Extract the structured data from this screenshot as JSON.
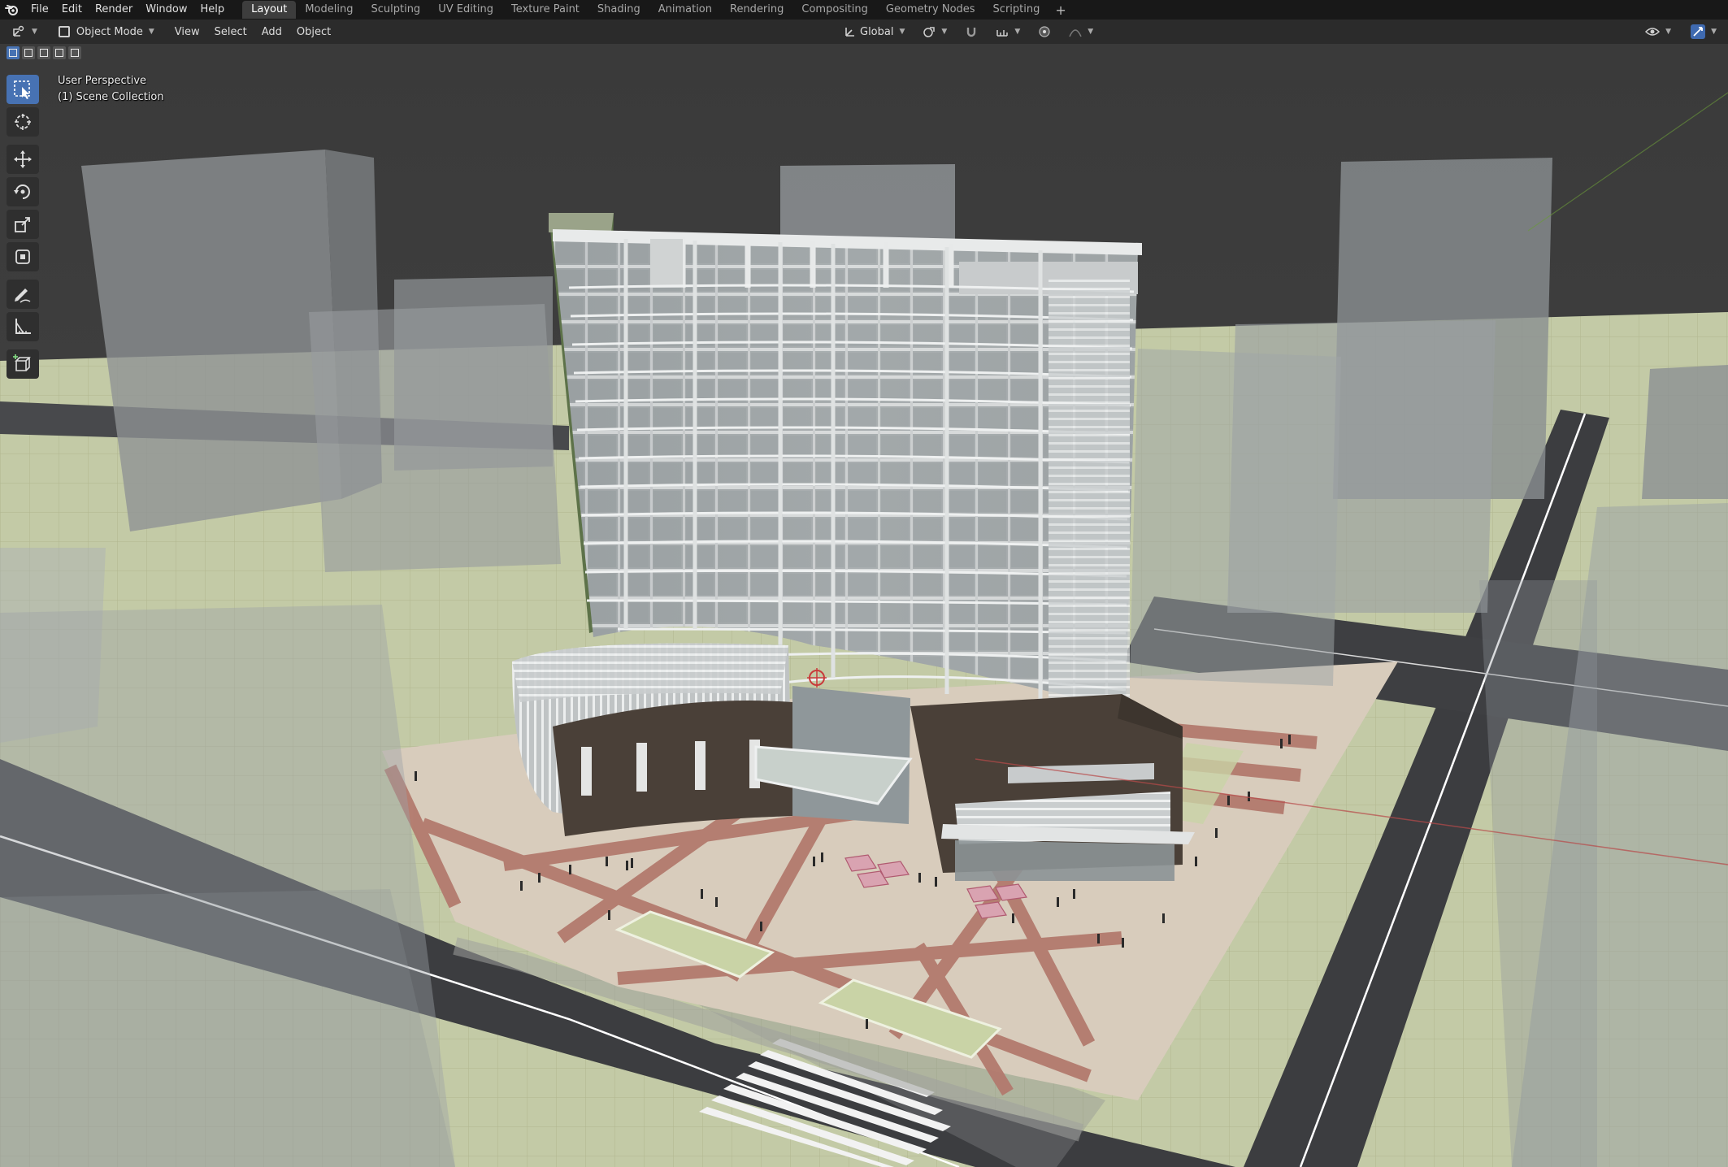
{
  "menubar": {
    "items": [
      "File",
      "Edit",
      "Render",
      "Window",
      "Help"
    ],
    "workspace_tabs": [
      {
        "label": "Layout",
        "active": true
      },
      {
        "label": "Modeling",
        "active": false
      },
      {
        "label": "Sculpting",
        "active": false
      },
      {
        "label": "UV Editing",
        "active": false
      },
      {
        "label": "Texture Paint",
        "active": false
      },
      {
        "label": "Shading",
        "active": false
      },
      {
        "label": "Animation",
        "active": false
      },
      {
        "label": "Rendering",
        "active": false
      },
      {
        "label": "Compositing",
        "active": false
      },
      {
        "label": "Geometry Nodes",
        "active": false
      },
      {
        "label": "Scripting",
        "active": false
      }
    ],
    "add_tab_label": "+"
  },
  "header": {
    "mode": "Object Mode",
    "menus": [
      "View",
      "Select",
      "Add",
      "Object"
    ],
    "transform_orientation": "Global"
  },
  "viewport": {
    "perspective_label": "User Perspective",
    "collection_label": "(1) Scene Collection"
  },
  "toolbar": {
    "tools": [
      "select-box",
      "cursor",
      "move",
      "rotate",
      "scale",
      "transform",
      "annotate",
      "measure",
      "add-cube"
    ],
    "active_tool": "select-box"
  },
  "colors": {
    "accent": "#4772b3",
    "viewport_background": "#3d3d3d",
    "ground": "#c2c9a4",
    "road": "#3c3d40",
    "plaza_paving": "#d8ccbc",
    "paving_stripes": "#b37a6e",
    "facade_dark": "#4a4038"
  }
}
